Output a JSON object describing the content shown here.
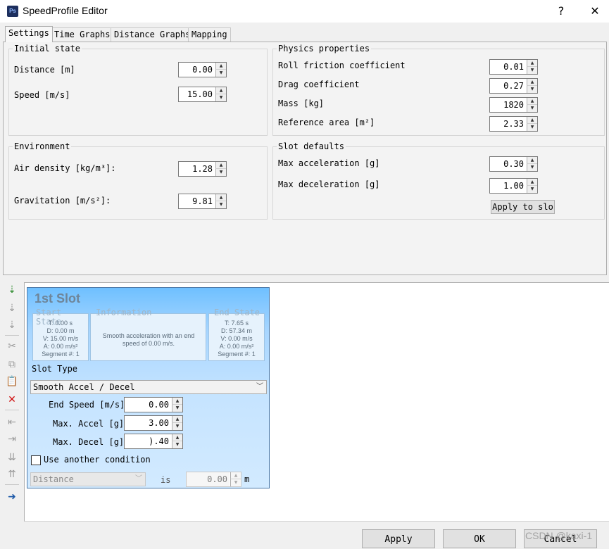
{
  "window": {
    "title": "SpeedProfile Editor",
    "icon_text": "Ps",
    "help_label": "?",
    "close_label": "✕"
  },
  "tabs": [
    {
      "label": "Settings",
      "active": true
    },
    {
      "label": "Time Graphs"
    },
    {
      "label": "Distance Graphs"
    },
    {
      "label": "Mapping"
    }
  ],
  "initial_state": {
    "title": "Initial state",
    "distance": {
      "label": "Distance [m]",
      "value": "0.00"
    },
    "speed": {
      "label": "Speed [m/s]",
      "value": "15.00"
    }
  },
  "physics": {
    "title": "Physics properties",
    "roll": {
      "label": "Roll friction coefficient",
      "value": "0.01"
    },
    "drag": {
      "label": "Drag coefficient",
      "value": "0.27"
    },
    "mass": {
      "label": "Mass [kg]",
      "value": "1820"
    },
    "area": {
      "label": "Reference area [m²]",
      "value": "2.33"
    }
  },
  "environment": {
    "title": "Environment",
    "air_density": {
      "label": "Air density [kg/m³]:",
      "value": "1.28"
    },
    "gravitation": {
      "label": "Gravitation [m/s²]:",
      "value": "9.81"
    }
  },
  "slot_defaults": {
    "title": "Slot defaults",
    "max_accel": {
      "label": "Max acceleration [g]",
      "value": "0.30"
    },
    "max_decel": {
      "label": "Max deceleration [g]",
      "value": "1.00"
    },
    "apply_button": "Apply to slo"
  },
  "slot": {
    "title": "1st Slot",
    "start": {
      "title": "Start",
      "title2": "State",
      "t": "T: 0.00 s",
      "d": "D: 0.00 m",
      "v": "V: 15.00 m/s",
      "a": "A: 0.00 m/s²",
      "seg": "Segment #: 1"
    },
    "info": {
      "title": "Information",
      "text": "Smooth acceleration with an end speed of 0.00 m/s."
    },
    "end": {
      "title": "End State",
      "t": "T: 7.65 s",
      "d": "D: 57.34 m",
      "v": "V: 0.00 m/s",
      "a": "A: 0.00 m/s²",
      "seg": "Segment #: 1"
    },
    "type_label": "Slot Type",
    "type_value": "Smooth Accel / Decel",
    "end_speed": {
      "label": "End Speed [m/s]:",
      "value": "0.00"
    },
    "max_accel": {
      "label": "Max. Accel [g]:",
      "value": "3.00"
    },
    "max_decel": {
      "label": "Max. Decel [g]:",
      "value": ").40"
    },
    "condition": {
      "label": "Use another condition",
      "checked": false
    },
    "cond_field": "Distance",
    "cond_is": "is",
    "cond_value": "0.00",
    "cond_unit": "m"
  },
  "toolbar_icons": [
    "add-slot-icon",
    "insert-slot-icon",
    "insert-slot-after-icon",
    "cut-slot-icon",
    "copy-slot-icon",
    "paste-slot-icon",
    "delete-slot-icon",
    "move-left-icon",
    "move-right-icon",
    "merge-icon",
    "split-icon",
    "export-icon"
  ],
  "footer": {
    "apply": "Apply",
    "ok": "OK",
    "cancel": "Cancel",
    "watermark": "CSDN @kaxi-1"
  }
}
